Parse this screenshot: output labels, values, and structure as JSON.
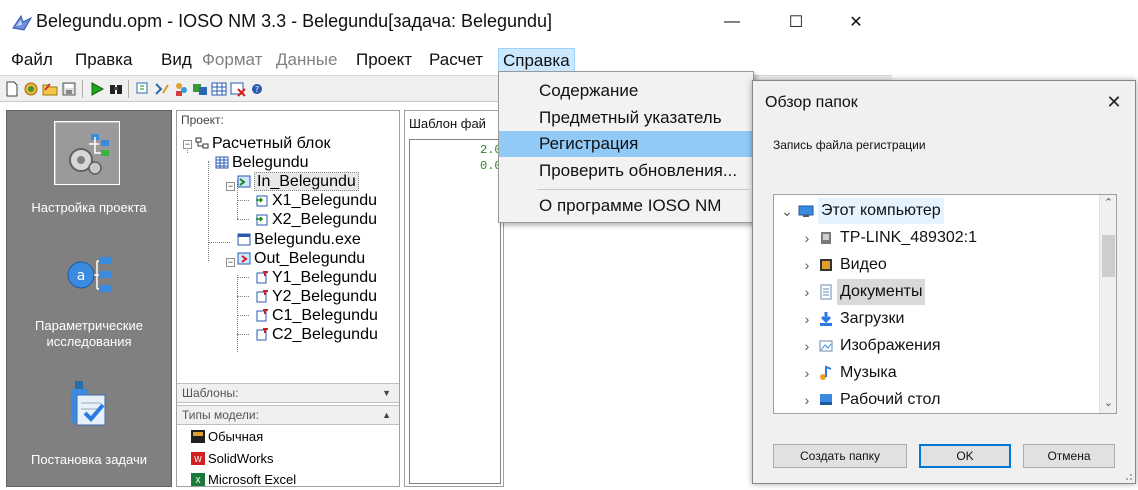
{
  "window": {
    "title": "Belegundu.opm - IOSO NM 3.3 - Belegundu[задача: Belegundu]",
    "minimize_glyph": "—",
    "maximize_glyph": "☐",
    "close_glyph": "✕"
  },
  "menubar": {
    "items": [
      {
        "label": "Файл",
        "enabled": true
      },
      {
        "label": "Правка",
        "enabled": true
      },
      {
        "label": "Вид",
        "enabled": true
      },
      {
        "label": "Формат",
        "enabled": false
      },
      {
        "label": "Данные",
        "enabled": false
      },
      {
        "label": "Проект",
        "enabled": true
      },
      {
        "label": "Расчет",
        "enabled": true
      },
      {
        "label": "Справка",
        "enabled": true,
        "active": true
      }
    ]
  },
  "toolbar": {
    "icons": [
      "new-file-icon",
      "open-icon",
      "open-folder-icon",
      "save-icon",
      "run-icon",
      "find-icon",
      "variables-icon",
      "add-var-icon",
      "users-icon",
      "model-icon",
      "table-icon",
      "delete-icon",
      "help-icon"
    ]
  },
  "left_panel": {
    "items": [
      {
        "label": "Настройка проекта",
        "selected": true
      },
      {
        "label": "Параметрические исследования",
        "selected": false
      },
      {
        "label": "Постановка задачи",
        "selected": false
      }
    ]
  },
  "project_panel": {
    "header": "Проект:",
    "tree": {
      "root": "Расчетный блок",
      "block": "Belegundu",
      "input_group": "In_Belegundu",
      "inputs": [
        "X1_Belegundu",
        "X2_Belegundu"
      ],
      "executable": "Belegundu.exe",
      "output_group": "Out_Belegundu",
      "outputs": [
        "Y1_Belegundu",
        "Y2_Belegundu",
        "C1_Belegundu",
        "C2_Belegundu"
      ]
    },
    "templates_label": "Шаблоны:",
    "model_types_label": "Типы модели:",
    "model_types": [
      "Обычная",
      "SolidWorks",
      "Microsoft Excel"
    ]
  },
  "template_panel": {
    "header": "Шаблон фай",
    "values": [
      "2.0",
      "0.0"
    ]
  },
  "help_menu": {
    "items": [
      "Содержание",
      "Предметный указатель",
      "Регистрация",
      "Проверить обновления...",
      "О программе IOSO NM"
    ],
    "hovered_index": 2
  },
  "dialog": {
    "title": "Обзор папок",
    "close_glyph": "✕",
    "description": "Запись файла регистрации",
    "folders": [
      {
        "label": "Этот компьютер",
        "expanded": true,
        "icon": "computer-icon"
      },
      {
        "label": "TP-LINK_489302:1",
        "icon": "media-device-icon"
      },
      {
        "label": "Видео",
        "icon": "video-folder-icon"
      },
      {
        "label": "Документы",
        "icon": "documents-folder-icon",
        "highlighted": true
      },
      {
        "label": "Загрузки",
        "icon": "downloads-folder-icon"
      },
      {
        "label": "Изображения",
        "icon": "pictures-folder-icon"
      },
      {
        "label": "Музыка",
        "icon": "music-folder-icon"
      },
      {
        "label": "Рабочий стол",
        "icon": "desktop-folder-icon"
      }
    ],
    "buttons": {
      "new_folder": "Создать папку",
      "ok": "OK",
      "cancel": "Отмена"
    }
  }
}
